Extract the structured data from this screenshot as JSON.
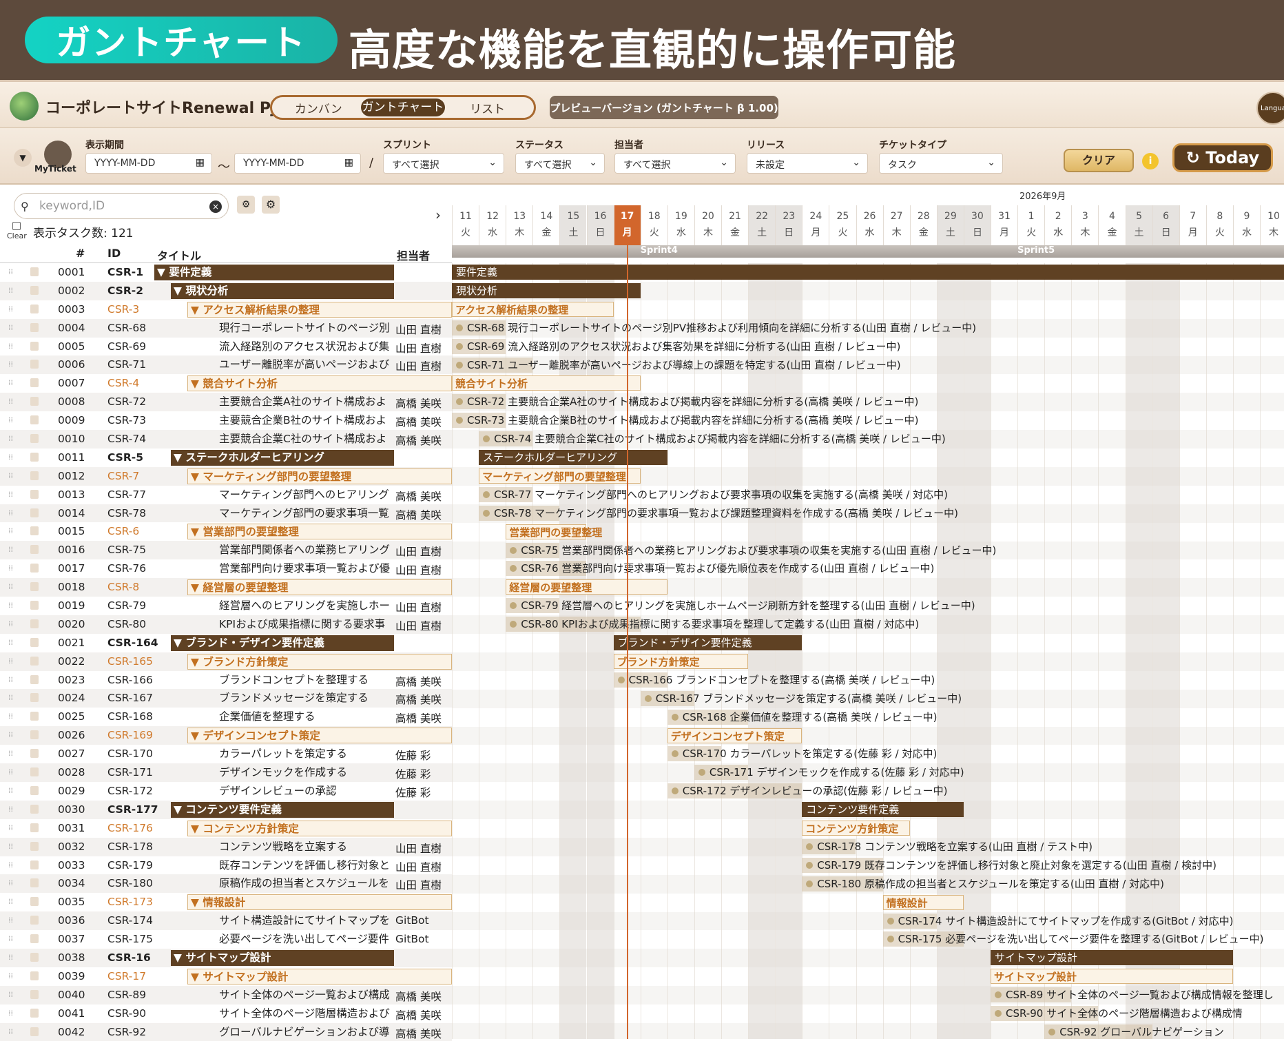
{
  "banner": {
    "pill": "ガントチャート",
    "headline": "高度な機能を直観的に操作可能"
  },
  "topbar": {
    "project": "コーポレートサイトRenewal Pjt",
    "views": [
      "カンバン",
      "ガントチャート",
      "リスト"
    ],
    "active_view": "ガントチャート",
    "preview": "プレビューバージョン (ガントチャート β 1.00)",
    "language": "Language"
  },
  "filters": {
    "myticket": "MyTicket",
    "period_label": "表示期間",
    "date_from": "YYYY-MM-DD",
    "date_to": "YYYY-MM-DD",
    "tilde": "～",
    "slash": "/",
    "sprint_label": "スプリント",
    "sprint_value": "すべて選択",
    "status_label": "ステータス",
    "status_value": "すべて選択",
    "assignee_label": "担当者",
    "assignee_value": "すべて選択",
    "release_label": "リリース",
    "release_value": "未設定",
    "ticket_label": "チケットタイプ",
    "ticket_value": "タスク",
    "clear": "クリア",
    "today": "Today"
  },
  "list": {
    "search_placeholder": "keyword,ID",
    "clear_label": "Clear",
    "task_count": "表示タスク数: 121",
    "col_num": "#",
    "col_id": "ID",
    "col_title": "タイトル",
    "col_assignee": "担当者"
  },
  "rows": [
    {
      "n": "0001",
      "id": "CSR-1",
      "t": "▼ 要件定義",
      "a": "",
      "k": "g1"
    },
    {
      "n": "0002",
      "id": "CSR-2",
      "t": "▼ 現状分析",
      "a": "",
      "k": "g2"
    },
    {
      "n": "0003",
      "id": "CSR-3",
      "t": "▼ アクセス解析結果の整理",
      "a": "",
      "k": "g3"
    },
    {
      "n": "0004",
      "id": "CSR-68",
      "t": "現行コーポレートサイトのページ別",
      "a": "山田 直樹",
      "k": "t"
    },
    {
      "n": "0005",
      "id": "CSR-69",
      "t": "流入経路別のアクセス状況および集",
      "a": "山田 直樹",
      "k": "t"
    },
    {
      "n": "0006",
      "id": "CSR-71",
      "t": "ユーザー離脱率が高いページおよび",
      "a": "山田 直樹",
      "k": "t"
    },
    {
      "n": "0007",
      "id": "CSR-4",
      "t": "▼ 競合サイト分析",
      "a": "",
      "k": "g3"
    },
    {
      "n": "0008",
      "id": "CSR-72",
      "t": "主要競合企業A社のサイト構成およ",
      "a": "高橋 美咲",
      "k": "t"
    },
    {
      "n": "0009",
      "id": "CSR-73",
      "t": "主要競合企業B社のサイト構成およ",
      "a": "高橋 美咲",
      "k": "t"
    },
    {
      "n": "0010",
      "id": "CSR-74",
      "t": "主要競合企業C社のサイト構成およ",
      "a": "高橋 美咲",
      "k": "t"
    },
    {
      "n": "0011",
      "id": "CSR-5",
      "t": "▼ ステークホルダーヒアリング",
      "a": "",
      "k": "g2"
    },
    {
      "n": "0012",
      "id": "CSR-7",
      "t": "▼ マーケティング部門の要望整理",
      "a": "",
      "k": "g3"
    },
    {
      "n": "0013",
      "id": "CSR-77",
      "t": "マーケティング部門へのヒアリング",
      "a": "高橋 美咲",
      "k": "t"
    },
    {
      "n": "0014",
      "id": "CSR-78",
      "t": "マーケティング部門の要求事項一覧",
      "a": "高橋 美咲",
      "k": "t"
    },
    {
      "n": "0015",
      "id": "CSR-6",
      "t": "▼ 営業部門の要望整理",
      "a": "",
      "k": "g3"
    },
    {
      "n": "0016",
      "id": "CSR-75",
      "t": "営業部門関係者への業務ヒアリング",
      "a": "山田 直樹",
      "k": "t"
    },
    {
      "n": "0017",
      "id": "CSR-76",
      "t": "営業部門向け要求事項一覧および優",
      "a": "山田 直樹",
      "k": "t"
    },
    {
      "n": "0018",
      "id": "CSR-8",
      "t": "▼ 経営層の要望整理",
      "a": "",
      "k": "g3"
    },
    {
      "n": "0019",
      "id": "CSR-79",
      "t": "経営層へのヒアリングを実施しホー",
      "a": "山田 直樹",
      "k": "t"
    },
    {
      "n": "0020",
      "id": "CSR-80",
      "t": "KPIおよび成果指標に関する要求事",
      "a": "山田 直樹",
      "k": "t"
    },
    {
      "n": "0021",
      "id": "CSR-164",
      "t": "▼ ブランド・デザイン要件定義",
      "a": "",
      "k": "g2"
    },
    {
      "n": "0022",
      "id": "CSR-165",
      "t": "▼ ブランド方針策定",
      "a": "",
      "k": "g3"
    },
    {
      "n": "0023",
      "id": "CSR-166",
      "t": "ブランドコンセプトを整理する",
      "a": "高橋 美咲",
      "k": "t"
    },
    {
      "n": "0024",
      "id": "CSR-167",
      "t": "ブランドメッセージを策定する",
      "a": "高橋 美咲",
      "k": "t"
    },
    {
      "n": "0025",
      "id": "CSR-168",
      "t": "企業価値を整理する",
      "a": "高橋 美咲",
      "k": "t"
    },
    {
      "n": "0026",
      "id": "CSR-169",
      "t": "▼ デザインコンセプト策定",
      "a": "",
      "k": "g3"
    },
    {
      "n": "0027",
      "id": "CSR-170",
      "t": "カラーパレットを策定する",
      "a": "佐藤 彩",
      "k": "t"
    },
    {
      "n": "0028",
      "id": "CSR-171",
      "t": "デザインモックを作成する",
      "a": "佐藤 彩",
      "k": "t"
    },
    {
      "n": "0029",
      "id": "CSR-172",
      "t": "デザインレビューの承認",
      "a": "佐藤 彩",
      "k": "t"
    },
    {
      "n": "0030",
      "id": "CSR-177",
      "t": "▼ コンテンツ要件定義",
      "a": "",
      "k": "g2"
    },
    {
      "n": "0031",
      "id": "CSR-176",
      "t": "▼ コンテンツ方針策定",
      "a": "",
      "k": "g3"
    },
    {
      "n": "0032",
      "id": "CSR-178",
      "t": "コンテンツ戦略を立案する",
      "a": "山田 直樹",
      "k": "t"
    },
    {
      "n": "0033",
      "id": "CSR-179",
      "t": "既存コンテンツを評価し移行対象と",
      "a": "山田 直樹",
      "k": "t"
    },
    {
      "n": "0034",
      "id": "CSR-180",
      "t": "原稿作成の担当者とスケジュールを",
      "a": "山田 直樹",
      "k": "t"
    },
    {
      "n": "0035",
      "id": "CSR-173",
      "t": "▼ 情報設計",
      "a": "",
      "k": "g3"
    },
    {
      "n": "0036",
      "id": "CSR-174",
      "t": "サイト構造設計にてサイトマップを",
      "a": "GitBot",
      "k": "t"
    },
    {
      "n": "0037",
      "id": "CSR-175",
      "t": "必要ページを洗い出してページ要件",
      "a": "GitBot",
      "k": "t"
    },
    {
      "n": "0038",
      "id": "CSR-16",
      "t": "▼ サイトマップ設計",
      "a": "",
      "k": "g2"
    },
    {
      "n": "0039",
      "id": "CSR-17",
      "t": "▼ サイトマップ設計",
      "a": "",
      "k": "g3"
    },
    {
      "n": "0040",
      "id": "CSR-89",
      "t": "サイト全体のページ一覧および構成",
      "a": "高橋 美咲",
      "k": "t"
    },
    {
      "n": "0041",
      "id": "CSR-90",
      "t": "サイト全体のページ階層構造および",
      "a": "高橋 美咲",
      "k": "t"
    },
    {
      "n": "0042",
      "id": "CSR-92",
      "t": "グローバルナビゲーションおよび導",
      "a": "高橋 美咲",
      "k": "t"
    }
  ],
  "timeline": {
    "month": "2026年9月",
    "days": [
      {
        "d": "11",
        "w": "火"
      },
      {
        "d": "12",
        "w": "水"
      },
      {
        "d": "13",
        "w": "木"
      },
      {
        "d": "14",
        "w": "金"
      },
      {
        "d": "15",
        "w": "土",
        "we": true
      },
      {
        "d": "16",
        "w": "日",
        "we": true
      },
      {
        "d": "17",
        "w": "月",
        "today": true
      },
      {
        "d": "18",
        "w": "火"
      },
      {
        "d": "19",
        "w": "水"
      },
      {
        "d": "20",
        "w": "木"
      },
      {
        "d": "21",
        "w": "金"
      },
      {
        "d": "22",
        "w": "土",
        "we": true
      },
      {
        "d": "23",
        "w": "日",
        "we": true
      },
      {
        "d": "24",
        "w": "月"
      },
      {
        "d": "25",
        "w": "火"
      },
      {
        "d": "26",
        "w": "水"
      },
      {
        "d": "27",
        "w": "木"
      },
      {
        "d": "28",
        "w": "金"
      },
      {
        "d": "29",
        "w": "土",
        "we": true
      },
      {
        "d": "30",
        "w": "日",
        "we": true
      },
      {
        "d": "31",
        "w": "月"
      },
      {
        "d": "1",
        "w": "火"
      },
      {
        "d": "2",
        "w": "水"
      },
      {
        "d": "3",
        "w": "木"
      },
      {
        "d": "4",
        "w": "金"
      },
      {
        "d": "5",
        "w": "土",
        "we": true
      },
      {
        "d": "6",
        "w": "日",
        "we": true
      },
      {
        "d": "7",
        "w": "月"
      },
      {
        "d": "8",
        "w": "火"
      },
      {
        "d": "9",
        "w": "水"
      },
      {
        "d": "10",
        "w": "木"
      }
    ],
    "sprints": [
      {
        "name": "Sprint4",
        "day": 7
      },
      {
        "name": "Sprint5",
        "day": 21
      }
    ]
  },
  "bars": [
    {
      "r": 0,
      "s": 0,
      "e": 31,
      "k": "gd",
      "l": "要件定義"
    },
    {
      "r": 1,
      "s": 0,
      "e": 7,
      "k": "gd",
      "l": "現状分析"
    },
    {
      "r": 2,
      "s": 0,
      "e": 6,
      "k": "gs",
      "l": "アクセス解析結果の整理"
    },
    {
      "r": 3,
      "s": 0,
      "e": 2,
      "k": "tk",
      "l": "CSR-68 現行コーポレートサイトのページ別PV推移および利用傾向を詳細に分析する(山田 直樹 / レビュー中)"
    },
    {
      "r": 4,
      "s": 0,
      "e": 2,
      "k": "tk",
      "l": "CSR-69 流入経路別のアクセス状況および集客効果を詳細に分析する(山田 直樹 / レビュー中)"
    },
    {
      "r": 5,
      "s": 0,
      "e": 3,
      "k": "tk",
      "l": "CSR-71 ユーザー離脱率が高いページおよび導線上の課題を特定する(山田 直樹 / レビュー中)"
    },
    {
      "r": 6,
      "s": 0,
      "e": 7,
      "k": "gs",
      "l": "競合サイト分析"
    },
    {
      "r": 7,
      "s": 0,
      "e": 2,
      "k": "tk",
      "l": "CSR-72 主要競合企業A社のサイト構成および掲載内容を詳細に分析する(高橋 美咲 / レビュー中)"
    },
    {
      "r": 8,
      "s": 0,
      "e": 2,
      "k": "tk",
      "l": "CSR-73 主要競合企業B社のサイト構成および掲載内容を詳細に分析する(高橋 美咲 / レビュー中)"
    },
    {
      "r": 9,
      "s": 1,
      "e": 3,
      "k": "tk",
      "l": "CSR-74 主要競合企業C社のサイト構成および掲載内容を詳細に分析する(高橋 美咲 / レビュー中)"
    },
    {
      "r": 10,
      "s": 1,
      "e": 8,
      "k": "gd",
      "l": "ステークホルダーヒアリング"
    },
    {
      "r": 11,
      "s": 1,
      "e": 7,
      "k": "gs",
      "l": "マーケティング部門の要望整理"
    },
    {
      "r": 12,
      "s": 1,
      "e": 3,
      "k": "tk",
      "l": "CSR-77 マーケティング部門へのヒアリングおよび要求事項の収集を実施する(高橋 美咲 / 対応中)"
    },
    {
      "r": 13,
      "s": 1,
      "e": 4,
      "k": "tk",
      "l": "CSR-78 マーケティング部門の要求事項一覧および課題整理資料を作成する(高橋 美咲 / レビュー中)"
    },
    {
      "r": 14,
      "s": 2,
      "e": 5,
      "k": "gs",
      "l": "営業部門の要望整理"
    },
    {
      "r": 15,
      "s": 2,
      "e": 4,
      "k": "tk",
      "l": "CSR-75 営業部門関係者への業務ヒアリングおよび要求事項の収集を実施する(山田 直樹 / レビュー中)"
    },
    {
      "r": 16,
      "s": 2,
      "e": 5,
      "k": "tk",
      "l": "CSR-76 営業部門向け要求事項一覧および優先順位表を作成する(山田 直樹 / レビュー中)"
    },
    {
      "r": 17,
      "s": 2,
      "e": 8,
      "k": "gs",
      "l": "経営層の要望整理"
    },
    {
      "r": 18,
      "s": 2,
      "e": 4,
      "k": "tk",
      "l": "CSR-79 経営層へのヒアリングを実施しホームページ刷新方針を整理する(山田 直樹 / レビュー中)"
    },
    {
      "r": 19,
      "s": 2,
      "e": 7,
      "k": "tk",
      "l": "CSR-80 KPIおよび成果指標に関する要求事項を整理して定義する(山田 直樹 / 対応中)"
    },
    {
      "r": 20,
      "s": 6,
      "e": 13,
      "k": "gd",
      "l": "ブランド・デザイン要件定義"
    },
    {
      "r": 21,
      "s": 6,
      "e": 11,
      "k": "gs",
      "l": "ブランド方針策定"
    },
    {
      "r": 22,
      "s": 6,
      "e": 8,
      "k": "tk",
      "l": "CSR-166 ブランドコンセプトを整理する(高橋 美咲 / レビュー中)"
    },
    {
      "r": 23,
      "s": 7,
      "e": 9,
      "k": "tk",
      "l": "CSR-167 ブランドメッセージを策定する(高橋 美咲 / レビュー中)"
    },
    {
      "r": 24,
      "s": 8,
      "e": 11,
      "k": "tk",
      "l": "CSR-168 企業価値を整理する(高橋 美咲 / レビュー中)"
    },
    {
      "r": 25,
      "s": 8,
      "e": 13,
      "k": "gs",
      "l": "デザインコンセプト策定"
    },
    {
      "r": 26,
      "s": 8,
      "e": 10,
      "k": "tk",
      "l": "CSR-170 カラーパレットを策定する(佐藤 彩 / 対応中)"
    },
    {
      "r": 27,
      "s": 9,
      "e": 11,
      "k": "tk",
      "l": "CSR-171 デザインモックを作成する(佐藤 彩 / 対応中)"
    },
    {
      "r": 28,
      "s": 8,
      "e": 13,
      "k": "tk",
      "l": "CSR-172 デザインレビューの承認(佐藤 彩 / レビュー中)"
    },
    {
      "r": 29,
      "s": 13,
      "e": 19,
      "k": "gd",
      "l": "コンテンツ要件定義"
    },
    {
      "r": 30,
      "s": 13,
      "e": 17,
      "k": "gs",
      "l": "コンテンツ方針策定"
    },
    {
      "r": 31,
      "s": 13,
      "e": 15,
      "k": "tk",
      "l": "CSR-178 コンテンツ戦略を立案する(山田 直樹 / テスト中)"
    },
    {
      "r": 32,
      "s": 13,
      "e": 16,
      "k": "tk",
      "l": "CSR-179 既存コンテンツを評価し移行対象と廃止対象を選定する(山田 直樹 / 検討中)"
    },
    {
      "r": 33,
      "s": 13,
      "e": 16,
      "k": "tk",
      "l": "CSR-180 原稿作成の担当者とスケジュールを策定する(山田 直樹 / 対応中)"
    },
    {
      "r": 34,
      "s": 16,
      "e": 19,
      "k": "gs",
      "l": "情報設計"
    },
    {
      "r": 35,
      "s": 16,
      "e": 18,
      "k": "tk",
      "l": "CSR-174 サイト構造設計にてサイトマップを作成する(GitBot / 対応中)"
    },
    {
      "r": 36,
      "s": 16,
      "e": 19,
      "k": "tk",
      "l": "CSR-175 必要ページを洗い出してページ要件を整理する(GitBot / レビュー中)"
    },
    {
      "r": 37,
      "s": 20,
      "e": 29,
      "k": "gd",
      "l": "サイトマップ設計"
    },
    {
      "r": 38,
      "s": 20,
      "e": 29,
      "k": "gs",
      "l": "サイトマップ設計"
    },
    {
      "r": 39,
      "s": 20,
      "e": 23,
      "k": "tk",
      "l": "CSR-89 サイト全体のページ一覧および構成情報を整理し"
    },
    {
      "r": 40,
      "s": 20,
      "e": 24,
      "k": "tk",
      "l": "CSR-90 サイト全体のページ階層構造および構成情"
    },
    {
      "r": 41,
      "s": 22,
      "e": 26,
      "k": "tk",
      "l": "CSR-92 グローバルナビゲーション"
    }
  ]
}
